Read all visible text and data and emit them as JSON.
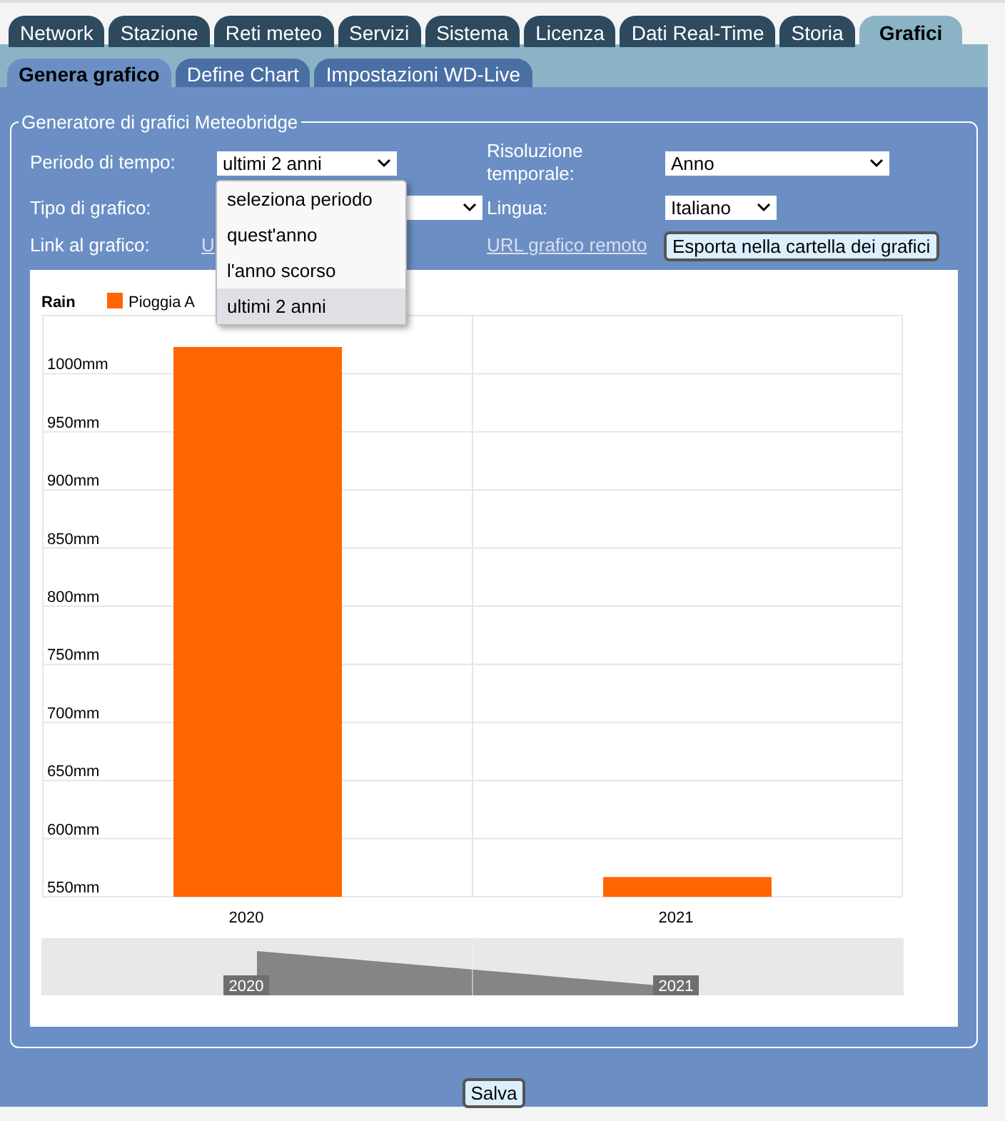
{
  "main_tabs": [
    {
      "label": "Network",
      "selected": false
    },
    {
      "label": "Stazione",
      "selected": false
    },
    {
      "label": "Reti meteo",
      "selected": false
    },
    {
      "label": "Servizi",
      "selected": false
    },
    {
      "label": "Sistema",
      "selected": false
    },
    {
      "label": "Licenza",
      "selected": false
    },
    {
      "label": "Dati Real-Time",
      "selected": false
    },
    {
      "label": "Storia",
      "selected": false
    },
    {
      "label": "Grafici",
      "selected": true
    }
  ],
  "sub_tabs": [
    {
      "label": "Genera grafico",
      "selected": true
    },
    {
      "label": "Define Chart",
      "selected": false
    },
    {
      "label": "Impostazioni WD-Live",
      "selected": false
    }
  ],
  "fieldset": {
    "legend": "Generatore di grafici Meteobridge"
  },
  "form": {
    "period": {
      "label": "Periodo di tempo:",
      "value": "ultimi 2 anni",
      "expanded": true,
      "options": [
        {
          "label": "seleziona periodo",
          "selected": false
        },
        {
          "label": "quest'anno",
          "selected": false
        },
        {
          "label": "l'anno scorso",
          "selected": false
        },
        {
          "label": "ultimi 2 anni",
          "selected": true
        }
      ]
    },
    "chart_type": {
      "label": "Tipo di grafico:"
    },
    "link": {
      "label": "Link al grafico:",
      "value": "U"
    },
    "resolution": {
      "label": "Risoluzione temporale:",
      "value": "Anno"
    },
    "language": {
      "label": "Lingua:",
      "value": "Italiano"
    },
    "remote_url": "URL grafico remoto",
    "export_button": "Esporta nella cartella dei grafici"
  },
  "chart": {
    "chart_data": {
      "type": "bar",
      "title": "Rain",
      "categories": [
        "2020",
        "2021"
      ],
      "series": [
        {
          "name": "Pioggia A",
          "color": "#ff6600",
          "values": [
            1023,
            567
          ]
        }
      ],
      "ylim": [
        550,
        1050
      ],
      "yticks": [
        {
          "value": 550,
          "label": "550mm"
        },
        {
          "value": 600,
          "label": "600mm"
        },
        {
          "value": 650,
          "label": "650mm"
        },
        {
          "value": 700,
          "label": "700mm"
        },
        {
          "value": 750,
          "label": "750mm"
        },
        {
          "value": 800,
          "label": "800mm"
        },
        {
          "value": 850,
          "label": "850mm"
        },
        {
          "value": 900,
          "label": "900mm"
        },
        {
          "value": 950,
          "label": "950mm"
        },
        {
          "value": 1000,
          "label": "1000mm"
        }
      ],
      "grid": true
    },
    "navigator": {
      "labels": [
        "2020",
        "2021"
      ]
    }
  },
  "save_button": "Salva"
}
